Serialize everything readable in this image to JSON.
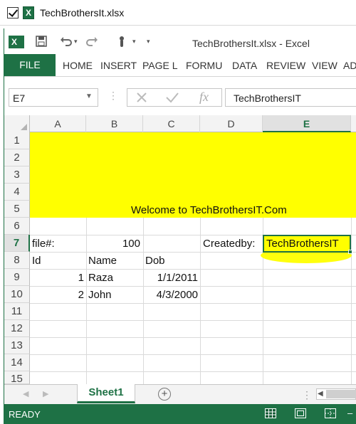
{
  "file_strip": {
    "filename": "TechBrothersIt.xlsx",
    "checked": true
  },
  "app": {
    "logo_letter": "X",
    "title": "TechBrothersIt.xlsx - Excel",
    "qat": {
      "undo_icon": "undo-icon",
      "redo_icon": "redo-icon",
      "touch_icon": "touch-mode-icon",
      "customize_icon": "customize-qat-icon"
    }
  },
  "ribbon": {
    "file_tab": "FILE",
    "tabs": [
      "HOME",
      "INSERT",
      "PAGE L",
      "FORMU",
      "DATA",
      "REVIEW",
      "VIEW",
      "AD"
    ]
  },
  "formula_bar": {
    "name_box": "E7",
    "fx": "fx",
    "value": "TechBrothersIT"
  },
  "grid": {
    "columns": [
      "A",
      "B",
      "C",
      "D",
      "E"
    ],
    "active_column": "E",
    "rows": [
      "1",
      "2",
      "3",
      "4",
      "5",
      "6",
      "7",
      "8",
      "9",
      "10",
      "11",
      "12",
      "13",
      "14",
      "15"
    ],
    "active_row": "7",
    "highlight_color": "#ffff00",
    "cells": {
      "banner": "Welcome to TechBrothersIT.Com",
      "a7": "file#:",
      "b7": "100",
      "d7": "Createdby:",
      "e7": "TechBrothersIT",
      "a8": "Id",
      "b8": "Name",
      "c8": "Dob",
      "a9": "1",
      "b9": "Raza",
      "c9": "1/1/2011",
      "a10": "2",
      "b10": "John",
      "c10": "4/3/2000"
    }
  },
  "sheets": {
    "active": "Sheet1",
    "add_label": "+"
  },
  "status": {
    "text": "READY"
  },
  "colors": {
    "accent": "#1e7145"
  }
}
